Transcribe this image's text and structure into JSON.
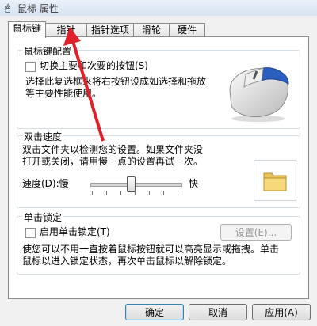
{
  "window": {
    "title": "鼠标 属性"
  },
  "tabs": [
    {
      "label": "鼠标键",
      "active": true
    },
    {
      "label": "指针",
      "active": false
    },
    {
      "label": "指针选项",
      "active": false
    },
    {
      "label": "滑轮",
      "active": false
    },
    {
      "label": "硬件",
      "active": false
    }
  ],
  "button_config": {
    "title": "鼠标键配置",
    "switch_label": "切换主要和次要的按钮(S)",
    "switch_checked": false,
    "description_line1": "选择此复选框来将右按钮设成如选择和拖放",
    "description_line2": "等主要性能使用。"
  },
  "double_click": {
    "title": "双击速度",
    "description_line1": "双击文件夹以检测您的设置。如果文件夹没",
    "description_line2": "打开或关闭，请用慢一点的设置再试一次。",
    "speed_label": "速度(D):慢",
    "fast_label": "快",
    "speed_value": 0.45
  },
  "click_lock": {
    "title": "单击锁定",
    "enable_label": "启用单击锁定(T)",
    "enable_checked": false,
    "settings_button": "设置(E)...",
    "description_line1": "使您可以不用一直按着鼠标按钮就可以高亮显示或拖拽。单击",
    "description_line2": "鼠标以进入锁定状态，再次单击鼠标以解除锁定。"
  },
  "footer": {
    "ok": "确定",
    "cancel": "取消",
    "apply": "应用(A)"
  },
  "colors": {
    "accent_arrow": "#e0202a",
    "mouse_highlight": "#2a5fbf"
  }
}
